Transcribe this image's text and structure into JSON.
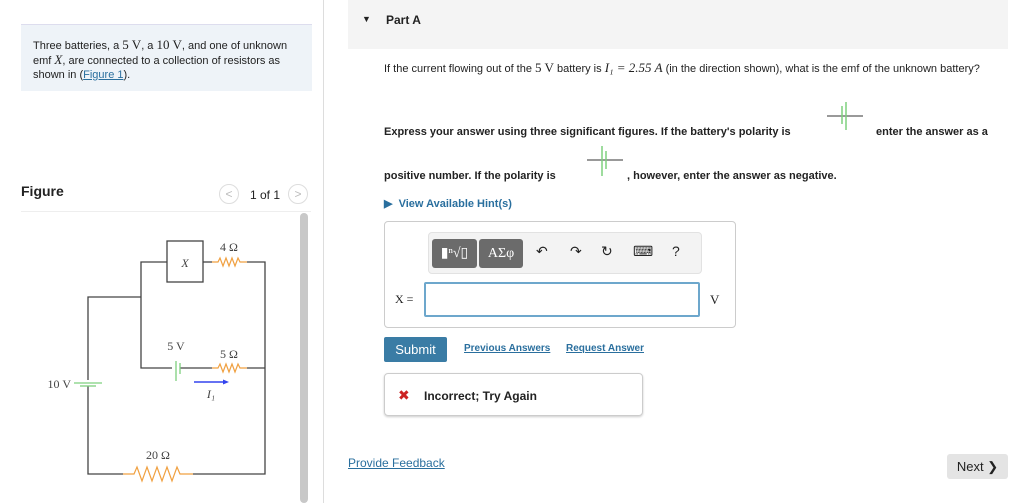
{
  "intro": {
    "text_a": "Three batteries, a ",
    "v1": "5 V",
    "text_b": ", a ",
    "v2": "10 V",
    "text_c": ", and one of unknown emf ",
    "x": "X",
    "text_d": ", are connected to a collection of resistors as shown in (",
    "link": "Figure 1",
    "text_e": ")."
  },
  "figure": {
    "title": "Figure",
    "pager": "1 of 1",
    "prev_icon": "chevron-left",
    "next_icon": "chevron-right",
    "labels": {
      "x": "X",
      "r4": "4 Ω",
      "v5": "5 V",
      "r5": "5 Ω",
      "i1": "I₁",
      "v10": "10 V",
      "r20": "20 Ω"
    },
    "colors": {
      "wire": "#444444",
      "resistor": "#f0a040",
      "battery": "#7ed07e",
      "current": "#3344ee"
    }
  },
  "part": {
    "title": "Part A",
    "question_a": "If the current flowing out of the ",
    "q5v": "5 V",
    "question_b": " battery is ",
    "i1": "I₁ = 2.55 A",
    "question_c": " (in the direction shown), what is the emf of the unknown battery?",
    "instr_a": "Express your answer using three significant figures. If the battery's polarity is",
    "instr_b": "enter the answer as a",
    "instr_c": "positive number.  If the polarity is",
    "instr_d": ", however, enter the answer as negative.",
    "hint": "View Available Hint(s)"
  },
  "editor": {
    "templates_btn": "▮ⁿ√▯",
    "symbols_btn": "ΑΣφ",
    "undo": "↶",
    "redo": "↷",
    "reset": "↻",
    "keyboard": "⌨",
    "help": "?",
    "label": "X =",
    "value": "",
    "unit": "V"
  },
  "actions": {
    "submit": "Submit",
    "previous": "Previous Answers",
    "request": "Request Answer"
  },
  "feedback": {
    "icon": "✖",
    "text": "Incorrect; Try Again",
    "color": "#cc2222"
  },
  "footer": {
    "provide_feedback": "Provide Feedback",
    "next": "Next ❯"
  }
}
